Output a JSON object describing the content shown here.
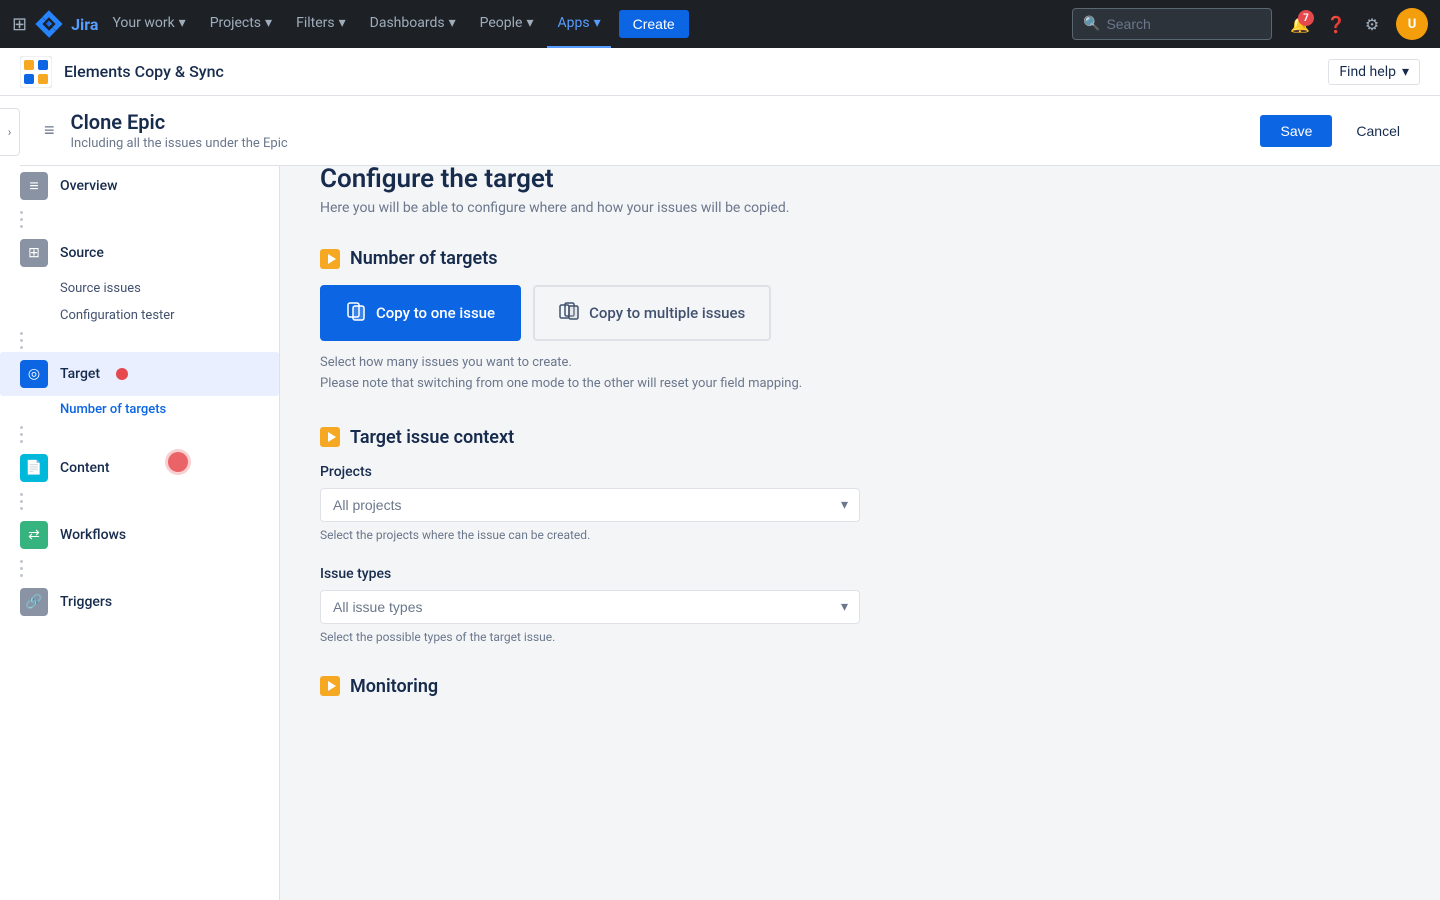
{
  "topnav": {
    "logo_text": "Jira",
    "items": [
      {
        "label": "Your work",
        "has_arrow": true,
        "active": false
      },
      {
        "label": "Projects",
        "has_arrow": true,
        "active": false
      },
      {
        "label": "Filters",
        "has_arrow": true,
        "active": false
      },
      {
        "label": "Dashboards",
        "has_arrow": true,
        "active": false
      },
      {
        "label": "People",
        "has_arrow": true,
        "active": false
      },
      {
        "label": "Apps",
        "has_arrow": true,
        "active": true
      }
    ],
    "create_label": "Create",
    "search_placeholder": "Search",
    "notification_count": "7"
  },
  "app_header": {
    "title": "Elements Copy & Sync",
    "find_help": "Find help"
  },
  "clone_banner": {
    "title": "Clone Epic",
    "subtitle": "Including all the issues under the Epic",
    "save_label": "Save",
    "cancel_label": "Cancel"
  },
  "sidebar": {
    "items": [
      {
        "id": "overview",
        "label": "Overview",
        "icon": "≡"
      },
      {
        "id": "source",
        "label": "Source",
        "icon": "⊞"
      },
      {
        "id": "source_issues",
        "label": "Source issues"
      },
      {
        "id": "config_tester",
        "label": "Configuration tester"
      },
      {
        "id": "target",
        "label": "Target",
        "icon": "◎",
        "active": true
      },
      {
        "id": "num_targets",
        "label": "Number of targets"
      },
      {
        "id": "content",
        "label": "Content",
        "icon": "📄"
      },
      {
        "id": "workflows",
        "label": "Workflows",
        "icon": "⇄"
      },
      {
        "id": "triggers",
        "label": "Triggers",
        "icon": "🔗"
      }
    ]
  },
  "content": {
    "title": "Configure the target",
    "subtitle": "Here you will be able to configure where and how your issues will be copied.",
    "number_of_targets": {
      "section_title": "Number of targets",
      "btn_one_label": "Copy to one issue",
      "btn_multi_label": "Copy to multiple issues",
      "help_text_line1": "Select how many issues you want to create.",
      "help_text_line2": "Please note that switching from one mode to the other will reset your field mapping."
    },
    "target_issue_context": {
      "section_title": "Target issue context",
      "projects_label": "Projects",
      "projects_placeholder": "All projects",
      "projects_hint": "Select the projects where the issue can be created.",
      "issue_types_label": "Issue types",
      "issue_types_placeholder": "All issue types",
      "issue_types_hint": "Select the possible types of the target issue."
    },
    "monitoring": {
      "section_title": "Monitoring"
    }
  }
}
